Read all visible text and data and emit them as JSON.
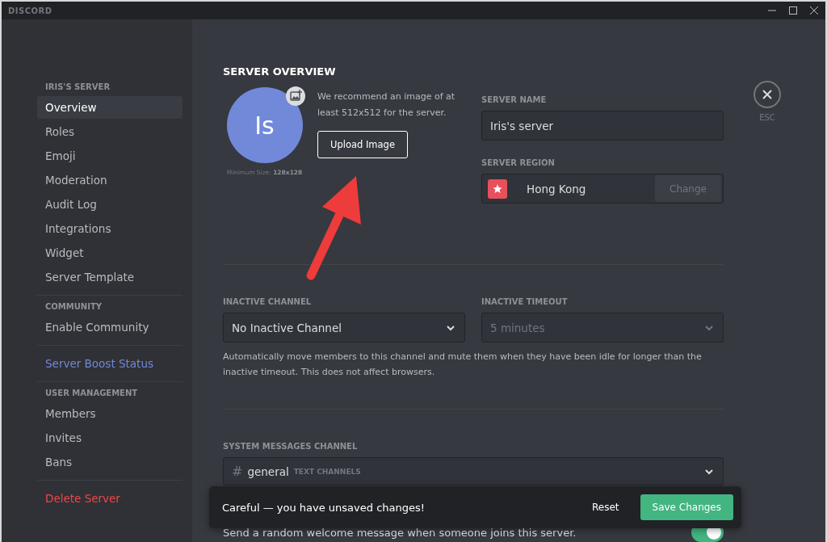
{
  "window": {
    "title": "DISCORD"
  },
  "sidebar": {
    "sections": [
      {
        "header": "IRIS'S SERVER",
        "items": [
          {
            "label": "Overview",
            "kind": "normal",
            "selected": true
          },
          {
            "label": "Roles",
            "kind": "normal",
            "selected": false
          },
          {
            "label": "Emoji",
            "kind": "normal",
            "selected": false
          },
          {
            "label": "Moderation",
            "kind": "normal",
            "selected": false
          },
          {
            "label": "Audit Log",
            "kind": "normal",
            "selected": false
          },
          {
            "label": "Integrations",
            "kind": "normal",
            "selected": false
          },
          {
            "label": "Widget",
            "kind": "normal",
            "selected": false
          },
          {
            "label": "Server Template",
            "kind": "normal",
            "selected": false
          }
        ]
      },
      {
        "header": "COMMUNITY",
        "items": [
          {
            "label": "Enable Community",
            "kind": "normal",
            "selected": false
          }
        ]
      },
      {
        "items": [
          {
            "label": "Server Boost Status",
            "kind": "boost",
            "selected": false
          }
        ]
      },
      {
        "header": "USER MANAGEMENT",
        "items": [
          {
            "label": "Members",
            "kind": "normal",
            "selected": false
          },
          {
            "label": "Invites",
            "kind": "normal",
            "selected": false
          },
          {
            "label": "Bans",
            "kind": "normal",
            "selected": false
          }
        ]
      },
      {
        "items": [
          {
            "label": "Delete Server",
            "kind": "danger",
            "selected": false
          }
        ]
      }
    ]
  },
  "main": {
    "title": "SERVER OVERVIEW",
    "close_label": "ESC",
    "icon": {
      "initials": "Is",
      "min_size": "Minimum Size: **128x128**"
    },
    "recommend_text": "We recommend an image of at least 512x512 for the server.",
    "upload_button": "Upload Image",
    "server_name": {
      "label": "SERVER NAME",
      "value": "Iris's server"
    },
    "server_region": {
      "label": "SERVER REGION",
      "value": "Hong Kong",
      "button": "Change"
    },
    "inactive_channel": {
      "label": "INACTIVE CHANNEL",
      "value": "No Inactive Channel",
      "disabled": false
    },
    "inactive_timeout": {
      "label": "INACTIVE TIMEOUT",
      "value": "5 minutes",
      "disabled": true
    },
    "inactive_help": "Automatically move members to this channel and mute them when they have been idle for longer than the inactive timeout. This does not affect browsers.",
    "system_channel": {
      "label": "SYSTEM MESSAGES CHANNEL",
      "prefix": "#",
      "value": "general",
      "category": "TEXT CHANNELS"
    },
    "welcome": {
      "label": "Send a random welcome message when someone joins this server.",
      "on": true
    }
  },
  "toast": {
    "message": "Careful — you have unsaved changes!",
    "reset": "Reset",
    "save": "Save Changes"
  }
}
